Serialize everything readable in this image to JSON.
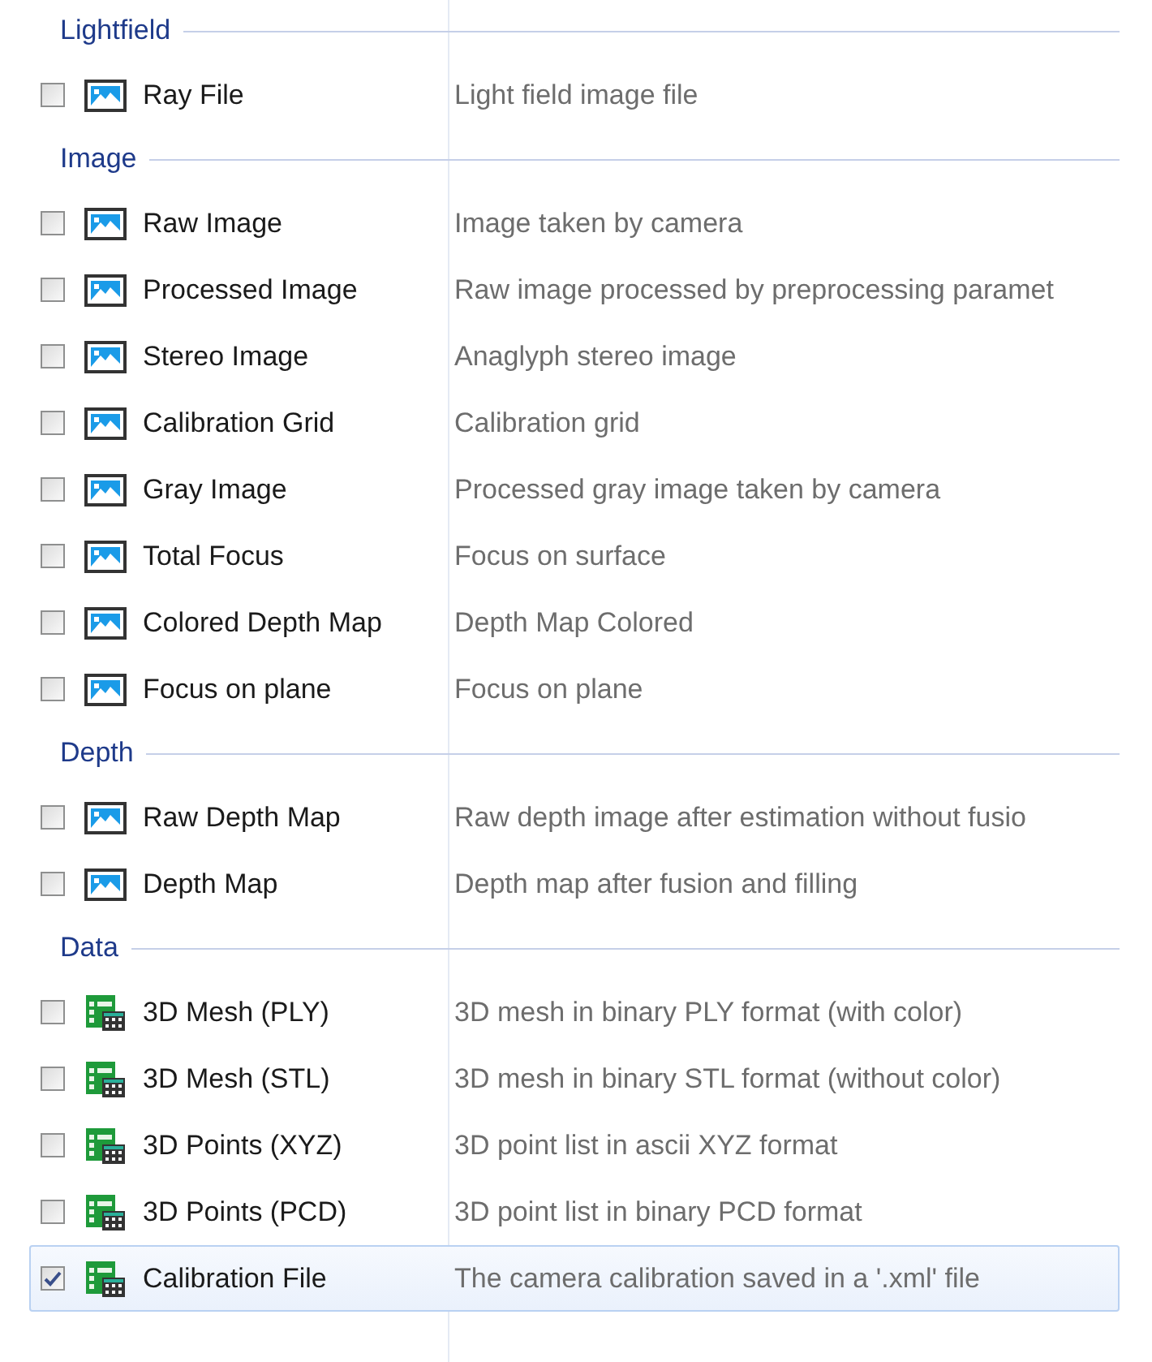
{
  "groups": [
    {
      "title": "Lightfield",
      "items": [
        {
          "name": "Ray File",
          "description": "Light field image file",
          "kind": "image",
          "checked": false,
          "selected": false
        }
      ]
    },
    {
      "title": "Image",
      "items": [
        {
          "name": "Raw Image",
          "description": "Image taken by camera",
          "kind": "image",
          "checked": false,
          "selected": false
        },
        {
          "name": "Processed Image",
          "description": "Raw image processed by preprocessing paramet",
          "kind": "image",
          "checked": false,
          "selected": false
        },
        {
          "name": "Stereo Image",
          "description": "Anaglyph stereo image",
          "kind": "image",
          "checked": false,
          "selected": false
        },
        {
          "name": "Calibration Grid",
          "description": "Calibration grid",
          "kind": "image",
          "checked": false,
          "selected": false
        },
        {
          "name": "Gray Image",
          "description": "Processed gray image taken by camera",
          "kind": "image",
          "checked": false,
          "selected": false
        },
        {
          "name": "Total Focus",
          "description": "Focus on surface",
          "kind": "image",
          "checked": false,
          "selected": false
        },
        {
          "name": "Colored Depth Map",
          "description": "Depth Map Colored",
          "kind": "image",
          "checked": false,
          "selected": false
        },
        {
          "name": "Focus on plane",
          "description": "Focus on plane",
          "kind": "image",
          "checked": false,
          "selected": false
        }
      ]
    },
    {
      "title": "Depth",
      "items": [
        {
          "name": "Raw Depth Map",
          "description": "Raw depth image after estimation without fusio",
          "kind": "image",
          "checked": false,
          "selected": false
        },
        {
          "name": "Depth Map",
          "description": "Depth map after fusion and filling",
          "kind": "image",
          "checked": false,
          "selected": false
        }
      ]
    },
    {
      "title": "Data",
      "items": [
        {
          "name": "3D Mesh (PLY)",
          "description": "3D mesh in binary PLY format (with color)",
          "kind": "data",
          "checked": false,
          "selected": false
        },
        {
          "name": "3D Mesh (STL)",
          "description": "3D mesh in binary STL format (without color)",
          "kind": "data",
          "checked": false,
          "selected": false
        },
        {
          "name": "3D Points (XYZ)",
          "description": "3D point list in ascii XYZ format",
          "kind": "data",
          "checked": false,
          "selected": false
        },
        {
          "name": "3D Points (PCD)",
          "description": "3D point list in binary PCD format",
          "kind": "data",
          "checked": false,
          "selected": false
        },
        {
          "name": "Calibration File",
          "description": "The camera calibration saved in a '.xml' file",
          "kind": "data",
          "checked": true,
          "selected": true
        }
      ]
    }
  ]
}
